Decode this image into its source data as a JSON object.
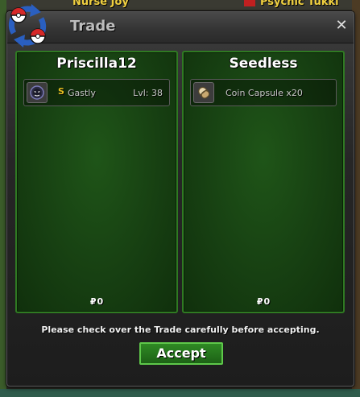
{
  "background": {
    "name_left": "Nurse Joy",
    "name_right": "Psychic Tukki"
  },
  "window": {
    "title": "Trade",
    "close_label": "✕"
  },
  "left_panel": {
    "player": "Priscilla12",
    "item": {
      "icon": "pokemon-sprite-icon",
      "badge": "S",
      "name": "Gastly",
      "level": "Lvl: 38"
    },
    "money_symbol": "₽",
    "money": "0"
  },
  "right_panel": {
    "player": "Seedless",
    "item": {
      "icon": "coin-capsule-icon",
      "name": "Coin Capsule  x20"
    },
    "money_symbol": "₽",
    "money": "0"
  },
  "notice": "Please check over the Trade carefully before accepting.",
  "accept_label": "Accept",
  "colors": {
    "panel_green": "#1f5518",
    "accept_green": "#2f8a24",
    "shiny_gold": "#e8c020"
  }
}
